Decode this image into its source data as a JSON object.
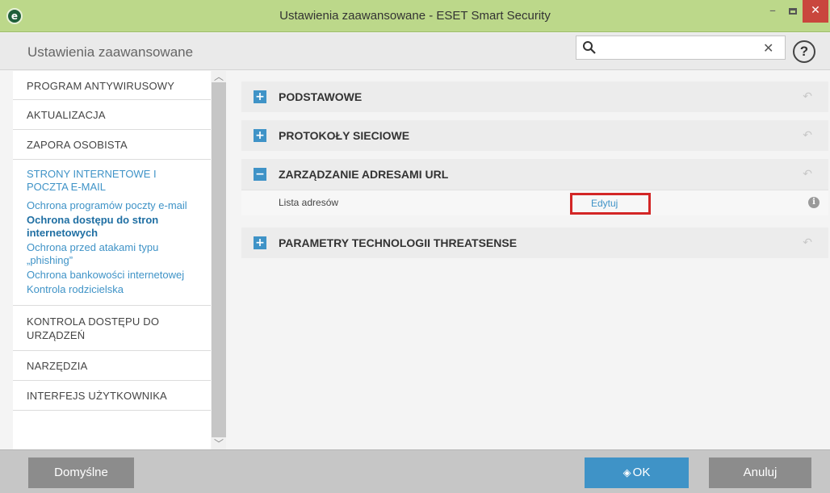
{
  "window": {
    "title": "Ustawienia zaawansowane - ESET Smart Security",
    "logo_letter": "e",
    "minimize": "–",
    "close": "✕"
  },
  "header": {
    "title": "Ustawienia zaawansowane",
    "search_value": "",
    "search_placeholder": "",
    "clear": "✕",
    "help": "?"
  },
  "sidebar": {
    "items": [
      {
        "label": "PROGRAM ANTYWIRUSOWY"
      },
      {
        "label": "AKTUALIZACJA"
      },
      {
        "label": "ZAPORA OSOBISTA"
      }
    ],
    "active_group": {
      "label": "STRONY INTERNETOWE I POCZTA E-MAIL",
      "sub_items": [
        {
          "label": "Ochrona programów poczty e-mail"
        },
        {
          "label": "Ochrona dostępu do stron internetowych"
        },
        {
          "label": "Ochrona przed atakami typu „phishing”"
        },
        {
          "label": "Ochrona bankowości internetowej"
        },
        {
          "label": "Kontrola rodzicielska"
        }
      ]
    },
    "items_after": [
      {
        "label": "KONTROLA DOSTĘPU DO URZĄDZEŃ"
      },
      {
        "label": "NARZĘDZIA"
      },
      {
        "label": "INTERFEJS UŻYTKOWNIKA"
      }
    ],
    "scroll_up": "︿",
    "scroll_down": "﹀"
  },
  "sections": [
    {
      "title": "PODSTAWOWE",
      "toggle": "+",
      "reset": "↶"
    },
    {
      "title": "PROTOKOŁY SIECIOWE",
      "toggle": "+",
      "reset": "↶"
    },
    {
      "title": "ZARZĄDZANIE ADRESAMI URL",
      "toggle": "−",
      "reset": "↶"
    },
    {
      "title": "PARAMETRY TECHNOLOGII THREATSENSE",
      "toggle": "+",
      "reset": "↶"
    }
  ],
  "url_list_row": {
    "label": "Lista adresów",
    "action": "Edytuj",
    "info": "i"
  },
  "footer": {
    "default_label": "Domyślne",
    "ok_label": "OK",
    "cancel_label": "Anuluj"
  },
  "colors": {
    "titlebar": "#bcd88a",
    "accent": "#3f93c7",
    "highlight_frame": "#d32626"
  }
}
